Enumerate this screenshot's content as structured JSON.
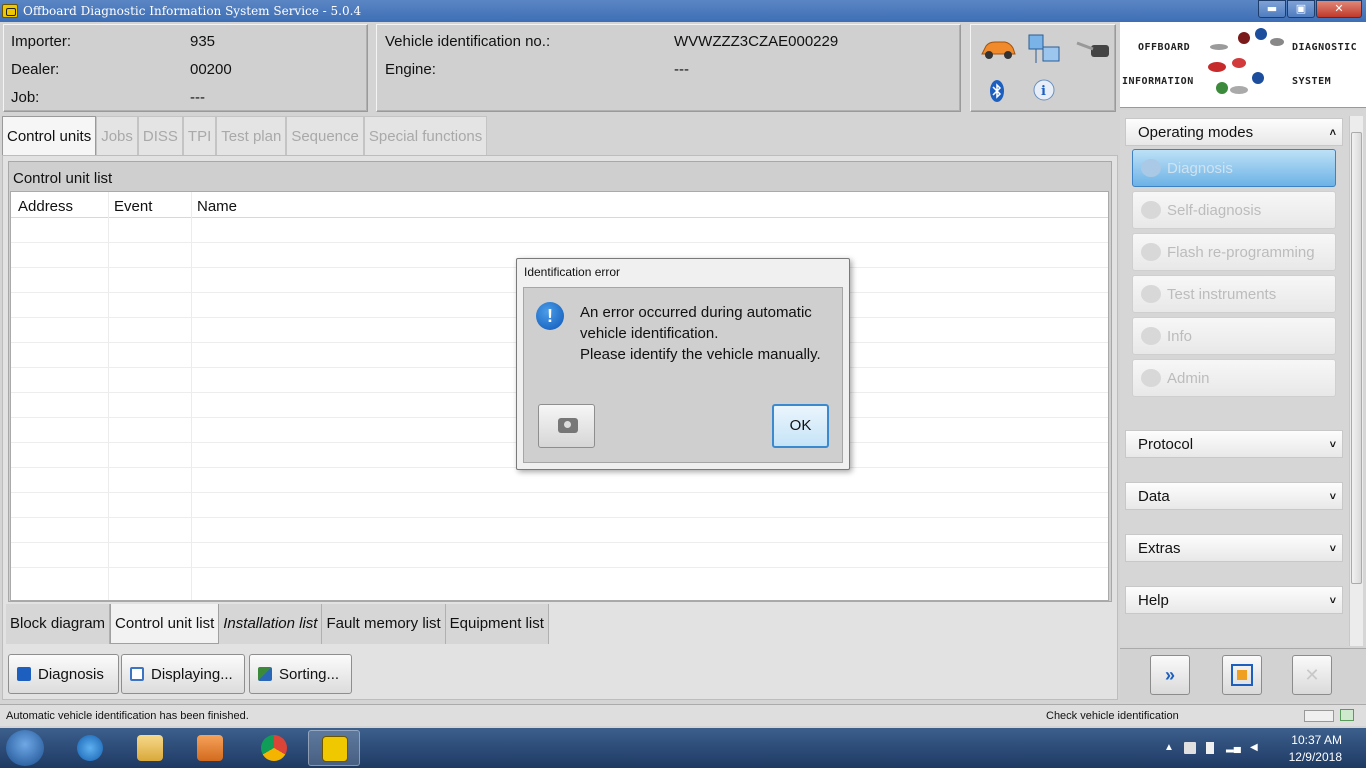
{
  "window": {
    "title": "Offboard Diagnostic Information System Service - 5.0.4",
    "min": "▬",
    "max": "▣",
    "close": "✕"
  },
  "info_left": {
    "importer_label": "Importer:",
    "importer_value": "935",
    "dealer_label": "Dealer:",
    "dealer_value": "00200",
    "job_label": "Job:",
    "job_value": "---"
  },
  "info_mid": {
    "vin_label": "Vehicle identification no.:",
    "vin_value": "WVWZZZ3CZAE000229",
    "engine_label": "Engine:",
    "engine_value": "---"
  },
  "logo": {
    "top_left": "OFFBOARD",
    "top_right": "DIAGNOSTIC",
    "bottom_left": "INFORMATION",
    "bottom_right": "SYSTEM"
  },
  "tabs": [
    "Control units",
    "Jobs",
    "DISS",
    "TPI",
    "Test plan",
    "Sequence",
    "Special functions"
  ],
  "control_unit_list": {
    "title": "Control unit list",
    "columns": [
      "Address",
      "Event",
      "Name"
    ]
  },
  "bottom_tabs": [
    "Block diagram",
    "Control unit list",
    "Installation list",
    "Fault memory list",
    "Equipment list"
  ],
  "actions": {
    "diagnosis": "Diagnosis",
    "displaying": "Displaying...",
    "sorting": "Sorting..."
  },
  "status": {
    "left": "Automatic vehicle identification has been finished.",
    "right": "Check vehicle identification"
  },
  "sidebar": {
    "operating_modes": "Operating modes",
    "modes": [
      "Diagnosis",
      "Self-diagnosis",
      "Flash re-programming",
      "Test instruments",
      "Info",
      "Admin"
    ],
    "sections": [
      "Protocol",
      "Data",
      "Extras",
      "Help"
    ],
    "chev_up": "˄",
    "chev_down": "˅"
  },
  "dialog": {
    "title": "Identification error",
    "line1": "An error occurred during automatic",
    "line2": "vehicle identification.",
    "line3": "Please identify the vehicle manually.",
    "ok": "OK",
    "icon_glyph": "!"
  },
  "side_buttons": {
    "forward": "»",
    "close": "✕"
  },
  "taskbar": {
    "time": "10:37 AM",
    "date": "12/9/2018"
  },
  "colors": {
    "titlebar": "#3d6eb5",
    "dialog_ok_border": "#3b8ad0",
    "active_mode": "#6db2e6"
  }
}
